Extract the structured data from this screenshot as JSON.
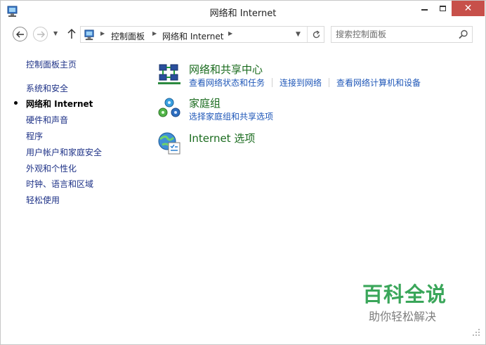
{
  "window": {
    "title": "网络和 Internet",
    "minimize_icon": "minimize-icon",
    "maximize_icon": "maximize-icon",
    "close_icon": "close-icon",
    "close_label": "✕",
    "close_color": "#c7504a"
  },
  "navigation": {
    "back_icon": "arrow-left-icon",
    "forward_icon": "arrow-right-icon",
    "recent_icon": "chevron-down-icon",
    "up_icon": "arrow-up-icon",
    "breadcrumbs": [
      "控制面板",
      "网络和 Internet"
    ],
    "search_placeholder": "搜索控制面板"
  },
  "sidebar": {
    "items": [
      {
        "label": "控制面板主页",
        "current": false
      },
      {
        "label": "系统和安全",
        "current": false
      },
      {
        "label": "网络和 Internet",
        "current": true
      },
      {
        "label": "硬件和声音",
        "current": false
      },
      {
        "label": "程序",
        "current": false
      },
      {
        "label": "用户帐户和家庭安全",
        "current": false
      },
      {
        "label": "外观和个性化",
        "current": false
      },
      {
        "label": "时钟、语言和区域",
        "current": false
      },
      {
        "label": "轻松使用",
        "current": false
      }
    ]
  },
  "categories": [
    {
      "title": "网络和共享中心",
      "icon": "network-sharing-center-icon",
      "links": [
        "查看网络状态和任务",
        "连接到网络",
        "查看网络计算机和设备"
      ]
    },
    {
      "title": "家庭组",
      "icon": "homegroup-icon",
      "links": [
        "选择家庭组和共享选项"
      ]
    },
    {
      "title": "Internet 选项",
      "icon": "internet-options-icon",
      "links": []
    }
  ],
  "colors": {
    "category_title": "#1a6b1e",
    "link": "#1f57b8",
    "sidebar_link": "#1e3287"
  },
  "watermark": {
    "title": "百科全说",
    "subtitle": "助你轻松解决"
  }
}
